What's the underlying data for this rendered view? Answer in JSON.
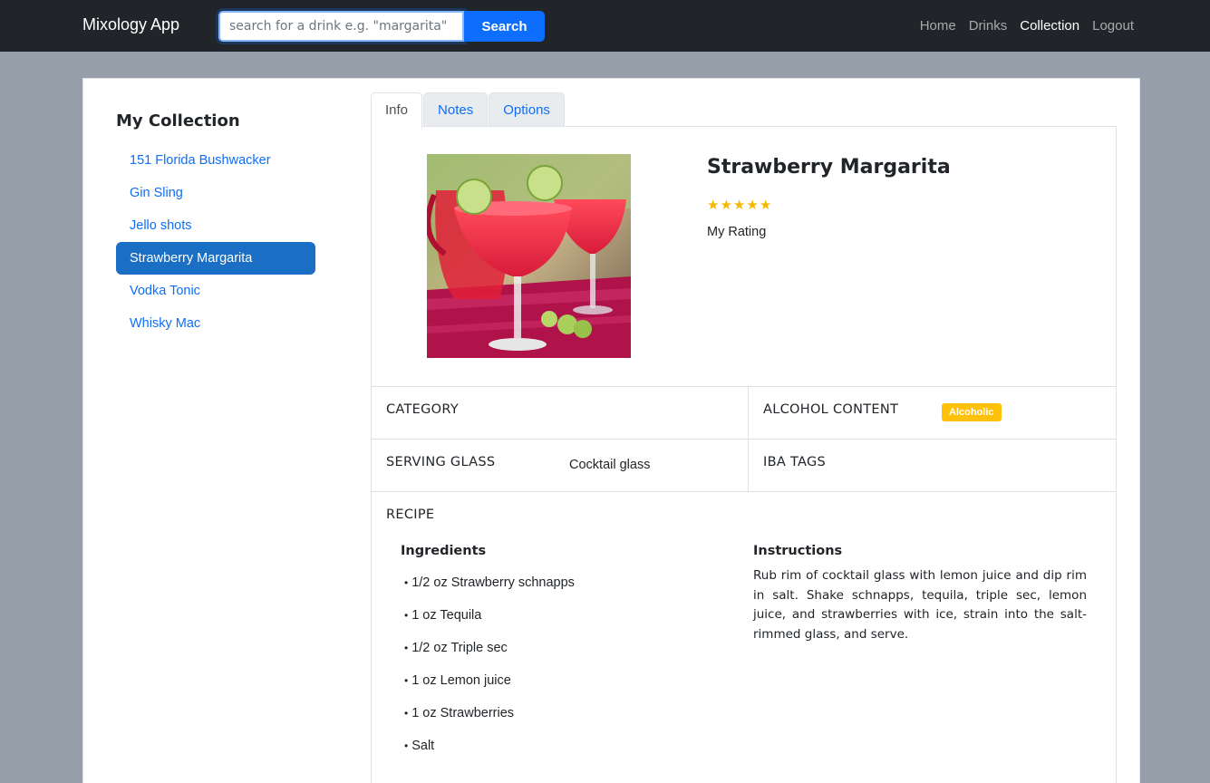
{
  "navbar": {
    "brand": "Mixology App",
    "search_placeholder": "search for a drink e.g. \"margarita\"",
    "search_button": "Search",
    "links": [
      "Home",
      "Drinks",
      "Collection",
      "Logout"
    ],
    "active_link": "Collection"
  },
  "sidebar": {
    "title": "My Collection",
    "items": [
      "151 Florida Bushwacker",
      "Gin Sling",
      "Jello shots",
      "Strawberry Margarita",
      "Vodka Tonic",
      "Whisky Mac"
    ],
    "active_item": "Strawberry Margarita"
  },
  "tabs": [
    "Info",
    "Notes",
    "Options"
  ],
  "active_tab": "Info",
  "drink": {
    "name": "Strawberry Margarita",
    "rating": 5,
    "rating_max": 5,
    "rating_label": "My Rating",
    "category_label": "CATEGORY",
    "category_value": "",
    "alcohol_label": "ALCOHOL CONTENT",
    "alcohol_badge": "Alcoholic",
    "glass_label": "SERVING GLASS",
    "glass_value": "Cocktail glass",
    "iba_label": "IBA TAGS",
    "iba_value": "",
    "recipe_label": "RECIPE",
    "ingredients_title": "Ingredients",
    "ingredients": [
      "1/2 oz Strawberry schnapps",
      "1 oz Tequila",
      "1/2 oz Triple sec",
      "1 oz Lemon juice",
      "1 oz Strawberries",
      "Salt"
    ],
    "instructions_title": "Instructions",
    "instructions": "Rub rim of cocktail glass with lemon juice and dip rim in salt. Shake schnapps, tequila, triple sec, lemon juice, and strawberries with ice, strain into the salt-rimmed glass, and serve."
  },
  "colors": {
    "navbar_bg": "#212529",
    "page_bg": "#959ea9",
    "primary": "#0d6efd",
    "active_item_bg": "#1a6fc4",
    "star": "#f5b800",
    "badge": "#ffc107"
  }
}
